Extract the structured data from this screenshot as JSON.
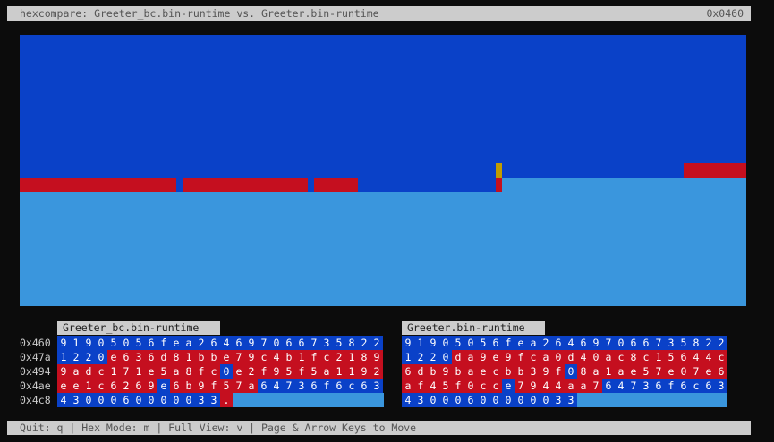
{
  "header": {
    "title": "hexcompare: Greeter_bc.bin-runtime vs. Greeter.bin-runtime",
    "offset": "0x0460"
  },
  "colors": {
    "background": "#0c0c0c",
    "bar": "#cccccc",
    "same": "#0a41c8",
    "diff": "#c50f1f",
    "empty": "#3a96dd",
    "marker": "#c19c00"
  },
  "left_panel": {
    "filename": "Greeter_bc.bin-runtime"
  },
  "right_panel": {
    "filename": "Greeter.bin-runtime"
  },
  "addresses": [
    "0x460",
    "0x47a",
    "0x494",
    "0x4ae",
    "0x4c8"
  ],
  "left_rows": [
    "91905056fea264697066735822",
    "1220e636d81bbe79c4b1fc2189",
    "9adc171e5a8fc0e2f95f5a1192",
    "ee1c6269e6b9f57a64736f6c63",
    "4300060000033."
  ],
  "left_flags": [
    "SSSSSSSSSSSSSSSSSSSSSSSSSS",
    "SSSSDDDDDDDDDDDDDDDDDDDDDD",
    "DDDDDDDDDDDDDSDDDDDDDDDDDD",
    "DDDDDDDDSDDDDDDDSSSSSSSSSS",
    "SSSSSSSSSSSSSD"
  ],
  "right_rows": [
    "91905056fea264697066735822",
    "1220da9e9fca0d40ac8c15644c",
    "6db9baecbb39f08a1ae57e07e6",
    "af45f0cce7944aa764736f6c63",
    "43000600000033"
  ],
  "right_flags": [
    "SSSSSSSSSSSSSSSSSSSSSSSSSS",
    "SSSSDDDDDDDDDDDDDDDDDDDDDD",
    "DDDDDDDDDDDDDSDDDDDDDDDDDD",
    "DDDDDDDDSDDDDDDDSSSSSSSSSS",
    "SSSSSSSSSSSSSS"
  ],
  "footer": {
    "help": "Quit: q | Hex Mode: m | Full View: v | Page & Arrow Keys to Move"
  }
}
